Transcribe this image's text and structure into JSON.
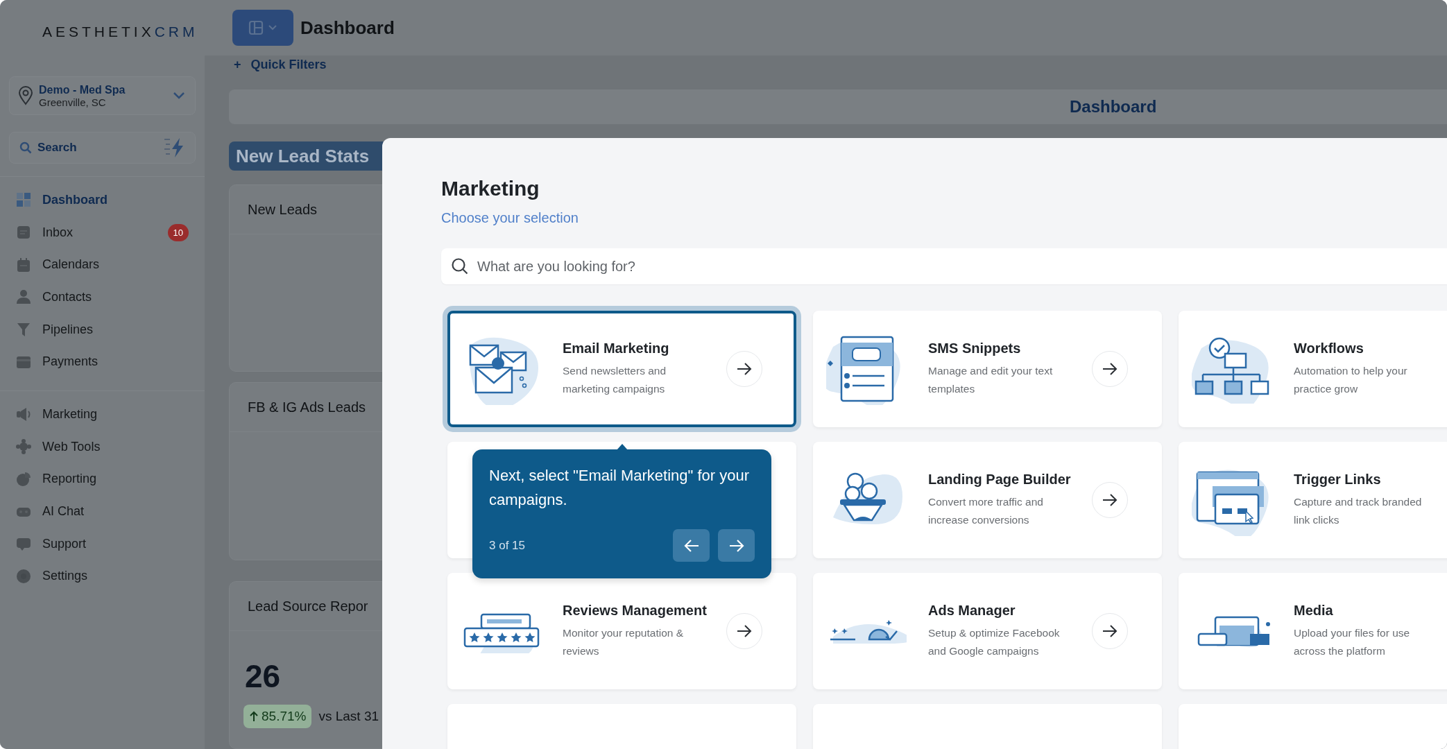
{
  "sidebar": {
    "logo": {
      "brand": "AESTHETIX",
      "suffix": "CRM"
    },
    "location": {
      "name": "Demo - Med Spa",
      "city": "Greenville, SC"
    },
    "search": {
      "label": "Search"
    },
    "nav": [
      {
        "label": "Dashboard",
        "selected": true
      },
      {
        "label": "Inbox",
        "badge": "10",
        "selected": false
      },
      {
        "label": "Calendars",
        "selected": false
      },
      {
        "label": "Contacts",
        "selected": false
      },
      {
        "label": "Pipelines",
        "selected": false
      },
      {
        "label": "Payments",
        "selected": false
      }
    ],
    "nav_more": [
      {
        "label": "Marketing",
        "selected": false
      },
      {
        "label": "Web Tools",
        "selected": false
      },
      {
        "label": "Reporting",
        "selected": false
      },
      {
        "label": "AI Chat",
        "selected": false
      },
      {
        "label": "Support",
        "selected": false
      },
      {
        "label": "Settings",
        "selected": false
      }
    ]
  },
  "header": {
    "title": "Dashboard",
    "filter_icon": "+",
    "quick_filters": "Quick Filters"
  },
  "dashboard": {
    "heading": "Dashboard",
    "section": "New Lead Stats",
    "cards": [
      {
        "title": "New Leads"
      },
      {
        "title": "FB & IG Ads Leads"
      },
      {
        "title": "Lead Source Repor",
        "value": "26",
        "change": "85.71%",
        "comparison": "vs Last 31"
      }
    ]
  },
  "modal": {
    "title": "Marketing",
    "subtitle": "Choose your selection",
    "search": {
      "placeholder": "What are you looking for?"
    },
    "cards": [
      {
        "kind": "option",
        "title": "Email Marketing",
        "description": "Send newsletters and marketing campaigns",
        "selected": true
      },
      {
        "kind": "option",
        "title": "SMS Snippets",
        "description": "Manage and edit your text templates",
        "selected": false
      },
      {
        "kind": "option",
        "title": "Workflows",
        "description": "Automation to help your practice grow",
        "selected": false
      },
      {
        "kind": "blank"
      },
      {
        "kind": "option",
        "title": "Landing Page Builder",
        "description": "Convert more traffic and increase conversions",
        "selected": false
      },
      {
        "kind": "option",
        "title": "Trigger Links",
        "description": "Capture and track branded link clicks",
        "selected": false
      },
      {
        "kind": "option",
        "title": "Reviews Management",
        "description": "Monitor your reputation & reviews",
        "selected": false
      },
      {
        "kind": "option",
        "title": "Ads Manager",
        "description": "Setup & optimize Facebook and Google campaigns",
        "selected": false
      },
      {
        "kind": "option",
        "title": "Media",
        "description": "Upload your files for use across the platform",
        "selected": false
      },
      {
        "kind": "blank"
      },
      {
        "kind": "blank"
      },
      {
        "kind": "blank"
      }
    ]
  },
  "tour": {
    "message": "Next, select \"Email Marketing\" for your campaigns.",
    "progress": "3 of 15"
  }
}
